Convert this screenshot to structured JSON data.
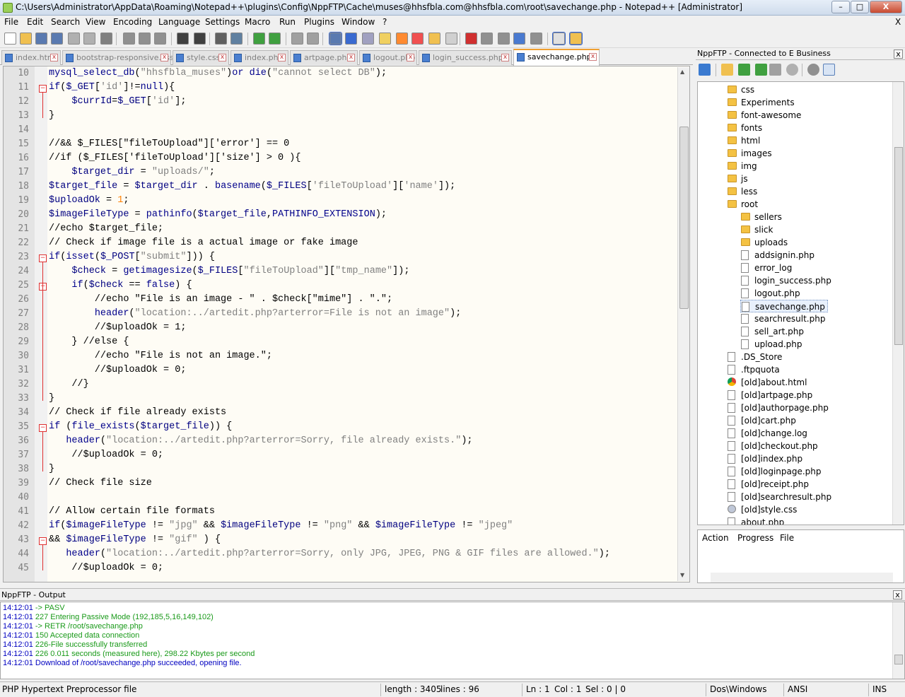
{
  "window": {
    "title": "C:\\Users\\Administrator\\AppData\\Roaming\\Notepad++\\plugins\\Config\\NppFTP\\Cache\\muses@hhsfbla.com@hhsfbla.com\\root\\savechange.php - Notepad++ [Administrator]",
    "minimize": "–",
    "maximize": "□",
    "close": "X"
  },
  "menu": [
    "File",
    "Edit",
    "Search",
    "View",
    "Encoding",
    "Language",
    "Settings",
    "Macro",
    "Run",
    "Plugins",
    "Window",
    "?"
  ],
  "menu_close": "X",
  "toolbar_icons": [
    "new-file-icon",
    "open-file-icon",
    "save-icon",
    "save-all-icon",
    "close-icon",
    "close-all-icon",
    "print-icon",
    "cut-icon",
    "copy-icon",
    "paste-icon",
    "undo-icon",
    "redo-icon",
    "find-icon",
    "replace-icon",
    "zoom-in-icon",
    "zoom-out-icon",
    "sync-v-icon",
    "sync-h-icon",
    "word-wrap-icon",
    "show-all-chars-icon",
    "indent-guide-icon",
    "udl-icon",
    "doc-map-icon",
    "function-list-icon",
    "folder-workspace-icon",
    "monitor-icon",
    "record-macro-icon",
    "stop-record-icon",
    "play-macro-icon",
    "run-macro-multiple-icon",
    "save-macro-icon",
    "spell-check-icon",
    "explorer-icon"
  ],
  "tabs": [
    {
      "label": "index.html",
      "active": false
    },
    {
      "label": "bootstrap-responsive.css",
      "active": false
    },
    {
      "label": "style.css",
      "active": false
    },
    {
      "label": "index.php",
      "active": false
    },
    {
      "label": "artpage.php",
      "active": false
    },
    {
      "label": "logout.php",
      "active": false
    },
    {
      "label": "login_success.php",
      "active": false
    },
    {
      "label": "savechange.php",
      "active": true
    }
  ],
  "tab_close": "x",
  "editor": {
    "lines": [
      {
        "n": "10",
        "text": "mysql_select_db(\"hhsfbla_muses\")or die(\"cannot select DB\");"
      },
      {
        "n": "11",
        "text": "if($_GET['id']!=null){"
      },
      {
        "n": "12",
        "text": "    $currId=$_GET['id'];"
      },
      {
        "n": "13",
        "text": "}"
      },
      {
        "n": "14",
        "text": ""
      },
      {
        "n": "15",
        "text": "//&& $_FILES[\"fileToUpload\"]['error'] == 0"
      },
      {
        "n": "16",
        "text": "//if ($_FILES['fileToUpload']['size'] > 0 ){"
      },
      {
        "n": "17",
        "text": "    $target_dir = \"uploads/\";"
      },
      {
        "n": "18",
        "text": "$target_file = $target_dir . basename($_FILES['fileToUpload']['name']);"
      },
      {
        "n": "19",
        "text": "$uploadOk = 1;"
      },
      {
        "n": "20",
        "text": "$imageFileType = pathinfo($target_file,PATHINFO_EXTENSION);"
      },
      {
        "n": "21",
        "text": "//echo $target_file;"
      },
      {
        "n": "22",
        "text": "// Check if image file is a actual image or fake image"
      },
      {
        "n": "23",
        "text": "if(isset($_POST[\"submit\"])) {"
      },
      {
        "n": "24",
        "text": "    $check = getimagesize($_FILES[\"fileToUpload\"][\"tmp_name\"]);"
      },
      {
        "n": "25",
        "text": "    if($check == false) {"
      },
      {
        "n": "26",
        "text": "        //echo \"File is an image - \" . $check[\"mime\"] . \".\";"
      },
      {
        "n": "27",
        "text": "        header(\"location:../artedit.php?arterror=File is not an image\");"
      },
      {
        "n": "28",
        "text": "        //$uploadOk = 1;"
      },
      {
        "n": "29",
        "text": "    } //else {"
      },
      {
        "n": "30",
        "text": "        //echo \"File is not an image.\";"
      },
      {
        "n": "31",
        "text": "        //$uploadOk = 0;"
      },
      {
        "n": "32",
        "text": "    //}"
      },
      {
        "n": "33",
        "text": "}"
      },
      {
        "n": "34",
        "text": "// Check if file already exists"
      },
      {
        "n": "35",
        "text": "if (file_exists($target_file)) {"
      },
      {
        "n": "36",
        "text": "   header(\"location:../artedit.php?arterror=Sorry, file already exists.\");"
      },
      {
        "n": "37",
        "text": "    //$uploadOk = 0;"
      },
      {
        "n": "38",
        "text": "}"
      },
      {
        "n": "39",
        "text": "// Check file size"
      },
      {
        "n": "40",
        "text": ""
      },
      {
        "n": "41",
        "text": "// Allow certain file formats"
      },
      {
        "n": "42",
        "text": "if($imageFileType != \"jpg\" && $imageFileType != \"png\" && $imageFileType != \"jpeg\""
      },
      {
        "n": "43",
        "text": "&& $imageFileType != \"gif\" ) {"
      },
      {
        "n": "44",
        "text": "   header(\"location:../artedit.php?arterror=Sorry, only JPG, JPEG, PNG & GIF files are allowed.\");"
      },
      {
        "n": "45",
        "text": "    //$uploadOk = 0;"
      }
    ]
  },
  "ftp_panel": {
    "title": "NppFTP - Connected to E Business",
    "close": "x",
    "tree": [
      {
        "label": "css",
        "type": "folder",
        "depth": 0
      },
      {
        "label": "Experiments",
        "type": "folder",
        "depth": 0
      },
      {
        "label": "font-awesome",
        "type": "folder",
        "depth": 0
      },
      {
        "label": "fonts",
        "type": "folder",
        "depth": 0
      },
      {
        "label": "html",
        "type": "folder",
        "depth": 0
      },
      {
        "label": "images",
        "type": "folder",
        "depth": 0
      },
      {
        "label": "img",
        "type": "folder",
        "depth": 0
      },
      {
        "label": "js",
        "type": "folder",
        "depth": 0
      },
      {
        "label": "less",
        "type": "folder",
        "depth": 0
      },
      {
        "label": "root",
        "type": "folder",
        "depth": 0
      },
      {
        "label": "sellers",
        "type": "folder",
        "depth": 1
      },
      {
        "label": "slick",
        "type": "folder",
        "depth": 1
      },
      {
        "label": "uploads",
        "type": "folder",
        "depth": 1
      },
      {
        "label": "addsignin.php",
        "type": "file",
        "depth": 1
      },
      {
        "label": "error_log",
        "type": "file",
        "depth": 1
      },
      {
        "label": "login_success.php",
        "type": "file",
        "depth": 1
      },
      {
        "label": "logout.php",
        "type": "file",
        "depth": 1
      },
      {
        "label": "savechange.php",
        "type": "file",
        "depth": 1,
        "selected": true
      },
      {
        "label": "searchresult.php",
        "type": "file",
        "depth": 1
      },
      {
        "label": "sell_art.php",
        "type": "file",
        "depth": 1
      },
      {
        "label": "upload.php",
        "type": "file",
        "depth": 1
      },
      {
        "label": ".DS_Store",
        "type": "file",
        "depth": 0
      },
      {
        "label": ".ftpquota",
        "type": "file",
        "depth": 0
      },
      {
        "label": "[old]about.html",
        "type": "chrome",
        "depth": 0
      },
      {
        "label": "[old]artpage.php",
        "type": "file",
        "depth": 0
      },
      {
        "label": "[old]authorpage.php",
        "type": "file",
        "depth": 0
      },
      {
        "label": "[old]cart.php",
        "type": "file",
        "depth": 0
      },
      {
        "label": "[old]change.log",
        "type": "file",
        "depth": 0
      },
      {
        "label": "[old]checkout.php",
        "type": "file",
        "depth": 0
      },
      {
        "label": "[old]index.php",
        "type": "file",
        "depth": 0
      },
      {
        "label": "[old]loginpage.php",
        "type": "file",
        "depth": 0
      },
      {
        "label": "[old]receipt.php",
        "type": "file",
        "depth": 0
      },
      {
        "label": "[old]searchresult.php",
        "type": "file",
        "depth": 0
      },
      {
        "label": "[old]style.css",
        "type": "gear",
        "depth": 0
      },
      {
        "label": "about.php",
        "type": "file",
        "depth": 0
      }
    ],
    "queue_headers": [
      "Action",
      "Progress",
      "File"
    ]
  },
  "output": {
    "title": "NppFTP - Output",
    "close": "x",
    "lines": [
      {
        "time": "14:12:01",
        "msg": "-> PASV",
        "color": "green"
      },
      {
        "time": "14:12:01",
        "msg": "227 Entering Passive Mode (192,185,5,16,149,102)",
        "color": "green"
      },
      {
        "time": "14:12:01",
        "msg": "-> RETR /root/savechange.php",
        "color": "green"
      },
      {
        "time": "14:12:01",
        "msg": "150 Accepted data connection",
        "color": "green"
      },
      {
        "time": "14:12:01",
        "msg": "226-File successfully transferred",
        "color": "green"
      },
      {
        "time": "14:12:01",
        "msg": "226 0.011 seconds (measured here), 298.22 Kbytes per second",
        "color": "green"
      },
      {
        "time": "14:12:01",
        "msg": "Download of /root/savechange.php succeeded, opening file.",
        "color": "blue"
      }
    ]
  },
  "status": {
    "filetype": "PHP Hypertext Preprocessor file",
    "length": "length : 3405",
    "lines": "lines : 96",
    "ln": "Ln : 1",
    "col": "Col : 1",
    "sel": "Sel : 0 | 0",
    "eol": "Dos\\Windows",
    "encoding": "ANSI",
    "mode": "INS"
  }
}
